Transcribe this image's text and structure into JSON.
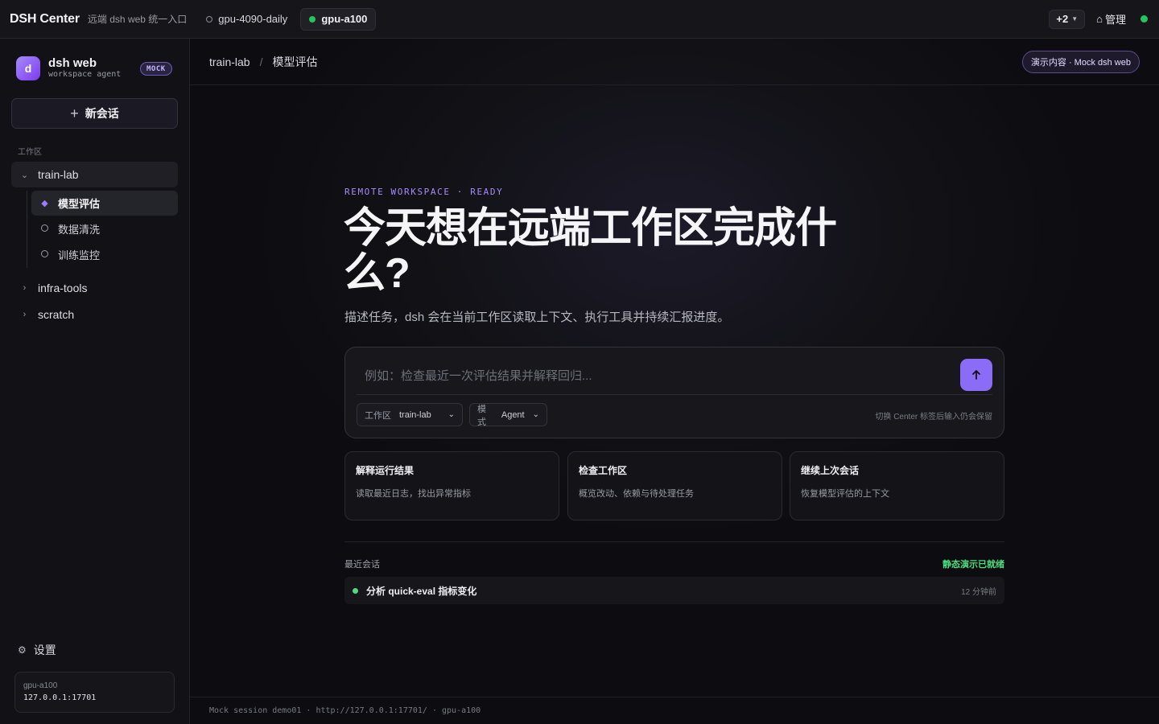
{
  "topbar": {
    "brand": "DSH Center",
    "brand_sub": "远端 dsh web 统一入口",
    "hosts": [
      {
        "label": "gpu-4090-daily",
        "status": "offline"
      },
      {
        "label": "gpu-a100",
        "status": "online"
      }
    ],
    "more_label": "+2",
    "admin_label": "管理",
    "status_color": "#22c55e"
  },
  "sidebar": {
    "avatar_letter": "d",
    "workspace_name": "dsh web",
    "workspace_sub": "workspace agent",
    "badge": "MOCK",
    "new_chat_label": "新会话",
    "section_label": "工作区",
    "projects": [
      {
        "label": "train-lab",
        "expanded": true,
        "children": [
          {
            "label": "模型评估",
            "selected": true
          },
          {
            "label": "数据清洗",
            "selected": false
          },
          {
            "label": "训练监控",
            "selected": false
          }
        ]
      },
      {
        "label": "infra-tools",
        "expanded": false
      },
      {
        "label": "scratch",
        "expanded": false
      }
    ],
    "settings_label": "设置",
    "host_card": {
      "name": "gpu-a100",
      "address": "127.0.0.1:17701"
    }
  },
  "main": {
    "breadcrumb": {
      "workspace": "train-lab",
      "sep": "/",
      "page": "模型评估"
    },
    "demo_badge": "演示内容 · Mock dsh web",
    "eyebrow": "REMOTE WORKSPACE · READY",
    "hero": "今天想在远端工作区完成什么?",
    "hero_sub": "描述任务，dsh 会在当前工作区读取上下文、执行工具并持续汇报进度。",
    "composer": {
      "placeholder": "例如：检查最近一次评估结果并解释回归...",
      "value": "",
      "workspace_key": "工作区",
      "workspace_value": "train-lab",
      "mode_key": "模式",
      "mode_value": "Agent",
      "hint": "切换 Center 标签后输入仍会保留"
    },
    "suggestions": [
      {
        "title": "解释运行结果",
        "desc": "读取最近日志，找出异常指标"
      },
      {
        "title": "检查工作区",
        "desc": "概览改动、依赖与待处理任务"
      },
      {
        "title": "继续上次会话",
        "desc": "恢复模型评估的上下文"
      }
    ],
    "recent": {
      "label": "最近会话",
      "status": "静态演示已就绪",
      "items": [
        {
          "title": "分析 quick-eval 指标变化",
          "time": "12 分钟前"
        }
      ]
    },
    "footer": "Mock session demo01 · http://127.0.0.1:17701/ · gpu-a100"
  }
}
